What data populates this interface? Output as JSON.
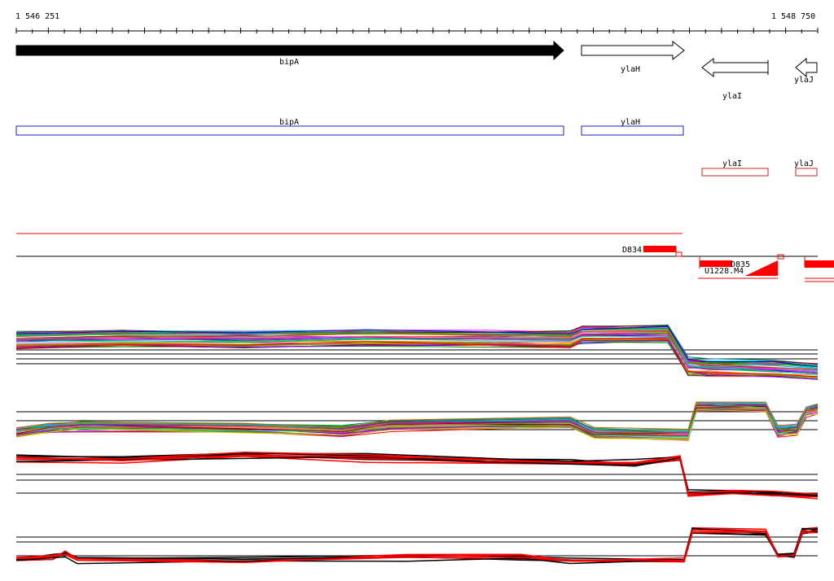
{
  "ruler": {
    "start_label": "1 546 251",
    "end_label": "1 548 750"
  },
  "genes": [
    {
      "name": "bipA",
      "strand": "+",
      "fill": "#000000"
    },
    {
      "name": "ylaH",
      "strand": "+",
      "fill": "#ffffff"
    },
    {
      "name": "ylaI",
      "strand": "-",
      "fill": "#ffffff"
    },
    {
      "name": "ylaJ",
      "strand": "-",
      "fill": "#ffffff"
    }
  ],
  "forward_features": [
    {
      "name": "bipA",
      "color": "#1c1cc8"
    },
    {
      "name": "ylaH",
      "color": "#1c1cc8"
    }
  ],
  "reverse_features": [
    {
      "name": "ylaI",
      "color": "#cc2222"
    },
    {
      "name": "ylaJ",
      "color": "#cc2222"
    }
  ],
  "signal_features": {
    "left_label": "D834",
    "right_label_top": "D835",
    "right_label_bottom": "U1228.M4",
    "color": "#ff0000"
  },
  "colors": {
    "red": "#ff0000",
    "black": "#000000",
    "axis": "#000000"
  },
  "expression_tracks": [
    {
      "id": "track-1"
    },
    {
      "id": "track-2"
    },
    {
      "id": "track-3"
    },
    {
      "id": "track-4"
    }
  ]
}
